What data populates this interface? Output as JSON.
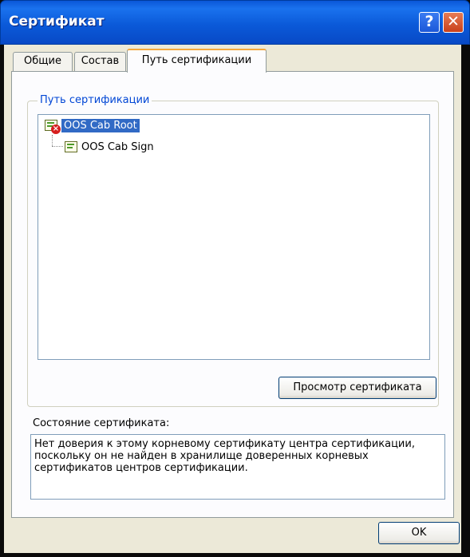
{
  "window": {
    "title": "Сертификат",
    "help_button": "?",
    "close_button": "✕"
  },
  "tabs": [
    {
      "label": "Общие",
      "active": false
    },
    {
      "label": "Состав",
      "active": false
    },
    {
      "label": "Путь сертификации",
      "active": true
    }
  ],
  "cert_path": {
    "group_label": "Путь сертификации",
    "items": [
      {
        "label": "OOS Cab Root",
        "selected": true,
        "icon": "cert-untrusted-icon"
      },
      {
        "label": "OOS Cab Sign",
        "selected": false,
        "icon": "cert-icon"
      }
    ],
    "view_button": "Просмотр сертификата"
  },
  "status": {
    "label": "Состояние сертификата:",
    "lines": [
      "Нет доверия к этому корневому сертификату центра сертификации,",
      "поскольку он не найден в хранилище доверенных корневых",
      "сертификатов центров сертификации."
    ]
  },
  "ok_button": "OK",
  "colors": {
    "titlebar": "#0a57d8",
    "selection": "#316ac5",
    "group_label": "#0046d5",
    "active_tab_accent": "#f4a73b",
    "dialog_bg": "#ece9d8"
  }
}
